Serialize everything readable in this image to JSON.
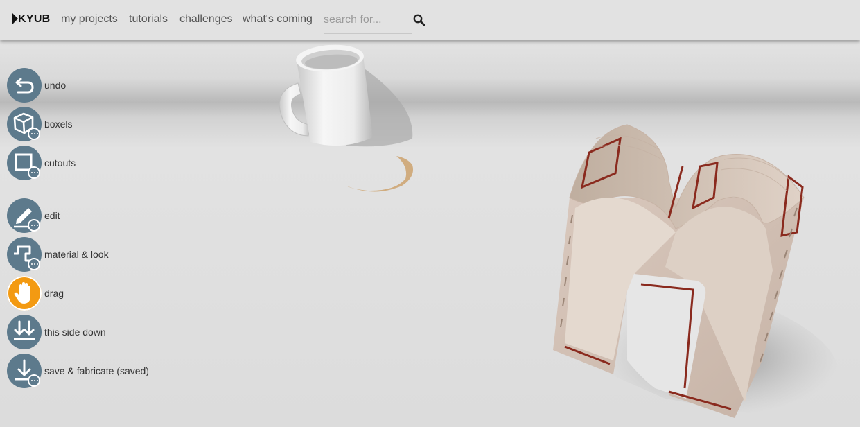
{
  "app": {
    "logo_text": "KYUB"
  },
  "nav": {
    "links": [
      "my projects",
      "tutorials",
      "challenges",
      "what's coming"
    ],
    "search_placeholder": "search for..."
  },
  "toolbar": {
    "items": [
      {
        "label": "undo",
        "icon": "undo-icon",
        "has_more": false,
        "active": false
      },
      {
        "label": "boxels",
        "icon": "cube-icon",
        "has_more": true,
        "active": false
      },
      {
        "label": "cutouts",
        "icon": "square-cutout-icon",
        "has_more": true,
        "active": false
      },
      {
        "label": "edit",
        "icon": "pencil-icon",
        "has_more": true,
        "active": false
      },
      {
        "label": "material & look",
        "icon": "material-icon",
        "has_more": true,
        "active": false
      },
      {
        "label": "drag",
        "icon": "hand-icon",
        "has_more": false,
        "active": true
      },
      {
        "label": "this side down",
        "icon": "side-down-icon",
        "has_more": false,
        "active": false
      },
      {
        "label": "save & fabricate (saved)",
        "icon": "save-download-icon",
        "has_more": true,
        "active": false
      }
    ]
  },
  "colors": {
    "tool_button": "#5d7a8c",
    "tool_active": "#f39a12",
    "background": "#dedede",
    "wood": "#d2c0b4",
    "trim": "#8a2a1e"
  }
}
